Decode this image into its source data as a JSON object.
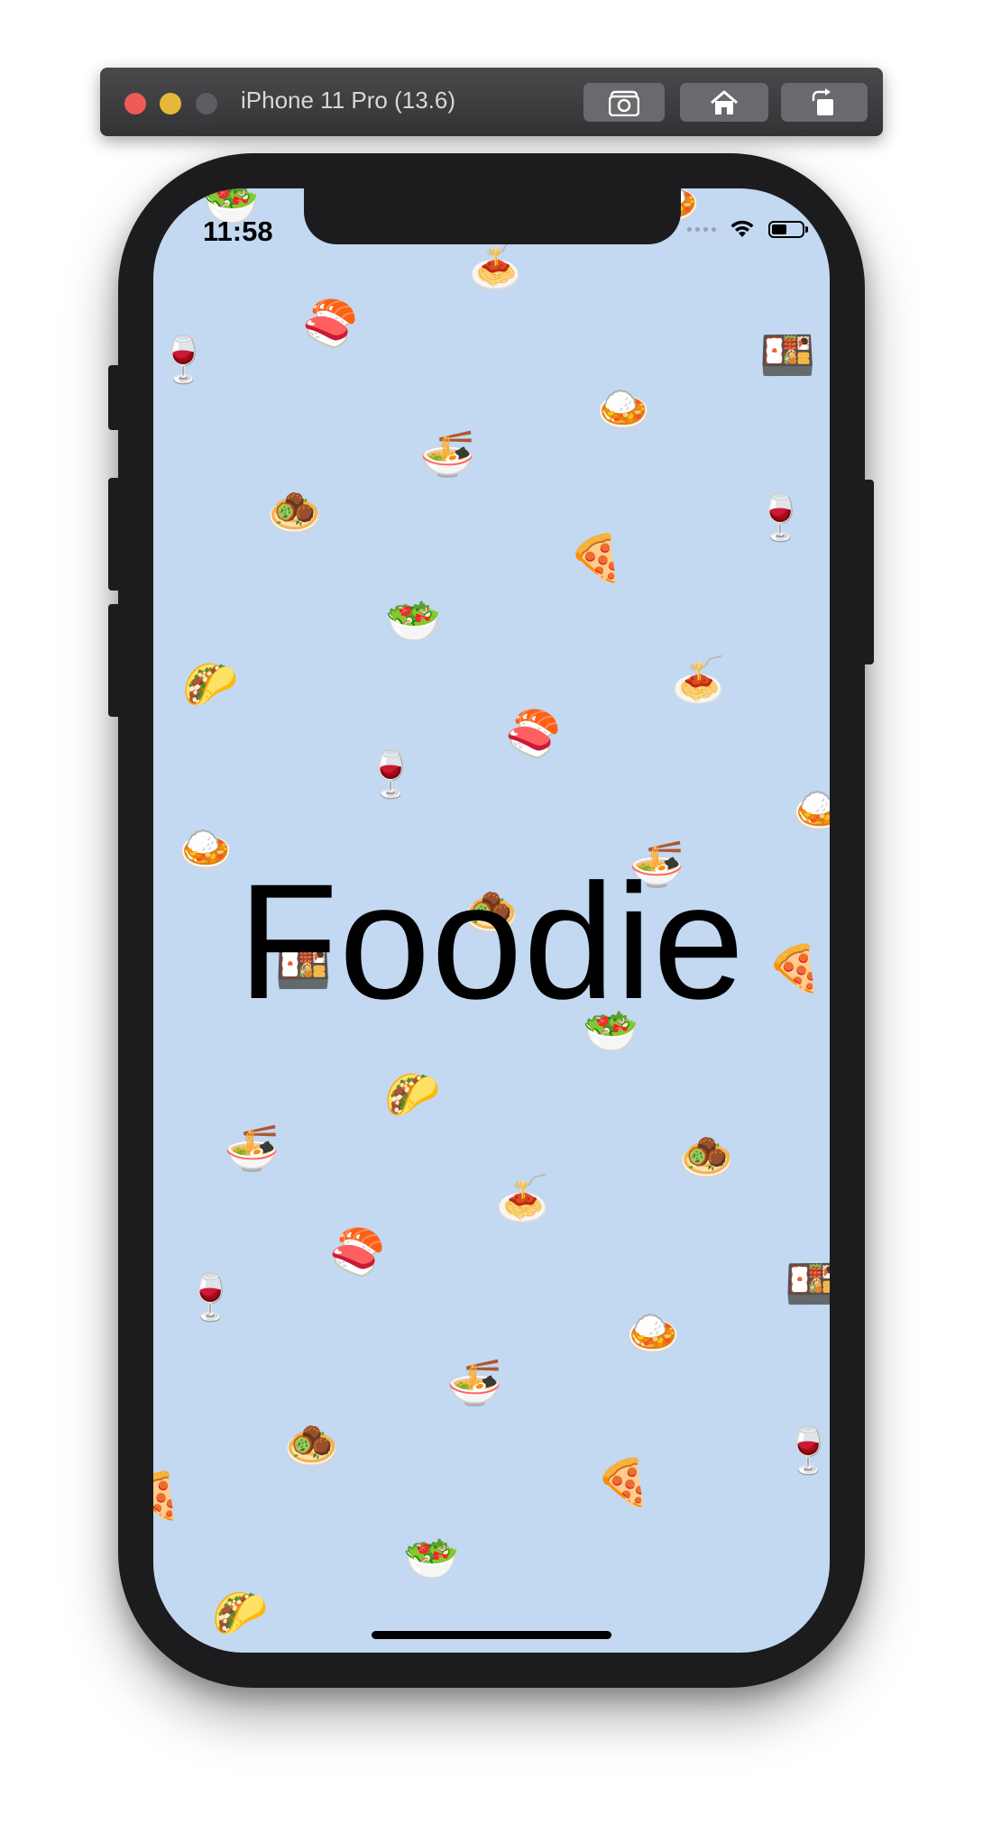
{
  "simulator": {
    "title": "iPhone 11 Pro (13.6)",
    "buttons": [
      {
        "name": "screenshot",
        "icon": "camera-icon"
      },
      {
        "name": "home",
        "icon": "home-icon"
      },
      {
        "name": "rotate",
        "icon": "rotate-icon"
      }
    ]
  },
  "status_bar": {
    "time": "11:58",
    "wifi_icon": "wifi-icon",
    "battery_icon": "battery-icon",
    "battery_level": 0.5
  },
  "app": {
    "title": "Foodie",
    "background_color": "#c3d8f1",
    "falling_food": [
      "🥗",
      "🍝",
      "🍣",
      "🍷",
      "🍱",
      "🍛",
      "🍜",
      "🧆",
      "🍕",
      "🌮"
    ]
  }
}
